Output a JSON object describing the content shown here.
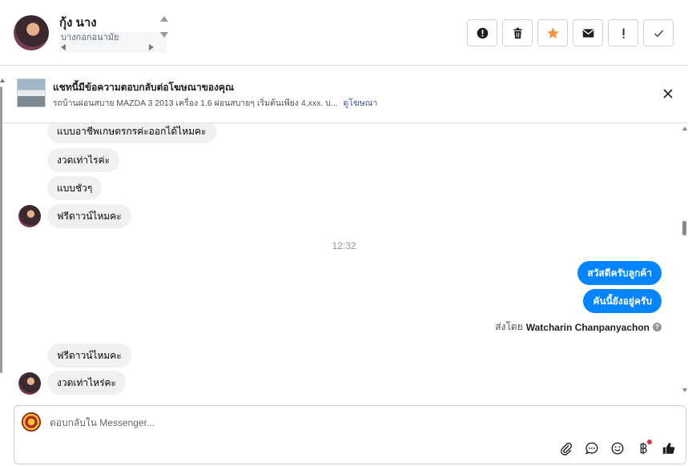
{
  "header": {
    "contact_name": "กุ้ง นาง",
    "contact_sub": "บางกอกอนามัย",
    "actions": [
      {
        "name": "report-button",
        "icon": "alert-circle-icon"
      },
      {
        "name": "delete-button",
        "icon": "trash-icon"
      },
      {
        "name": "star-button",
        "icon": "star-icon"
      },
      {
        "name": "mark-unread-button",
        "icon": "envelope-icon"
      },
      {
        "name": "follow-up-button",
        "icon": "exclamation-icon"
      },
      {
        "name": "mark-done-button",
        "icon": "checkmark-icon"
      }
    ]
  },
  "ad_banner": {
    "title": "แชทนี้มีข้อความตอบกลับต่อโฆษณาของคุณ",
    "description": "รถบ้านผ่อนสบาย MAZDA 3 2013 เครื่อง 1.6 ผ่อนสบายๆ เริ่มต้นเพียง 4,xxx. บ...",
    "link_label": "ดูโฆษณา"
  },
  "conversation": {
    "incoming_top": [
      {
        "text": "แบบอาชีพเกษตรกรค่ะออกได้ไหมคะ"
      },
      {
        "text": "งวดเท่าไรค่ะ"
      },
      {
        "text": "แบบชัวๆ"
      },
      {
        "text": "ฟรีดาวน์ไหมคะ"
      }
    ],
    "timestamp": "12:32",
    "outgoing": [
      {
        "text": "สวัสดีครับลูกค้า"
      },
      {
        "text": "คันนี้ยังอยู่ครับ"
      }
    ],
    "sent_by_label": "ส่งโดย",
    "sent_by_name": "Watcharin Chanpanyachon",
    "incoming_bottom": [
      {
        "text": "ฟรีดาวน์ไหมคะ"
      },
      {
        "text": "งวดเท่าไหร่คะ"
      }
    ]
  },
  "composer": {
    "placeholder": "ตอบกลับใน Messenger...",
    "tools": [
      "paperclip-icon",
      "chat-bubble-icon",
      "emoji-icon",
      "baht-icon",
      "thumbs-up-icon"
    ]
  },
  "colors": {
    "accent": "#0084ff",
    "star": "#f7923a",
    "incoming_bubble": "#f0f0f0"
  }
}
